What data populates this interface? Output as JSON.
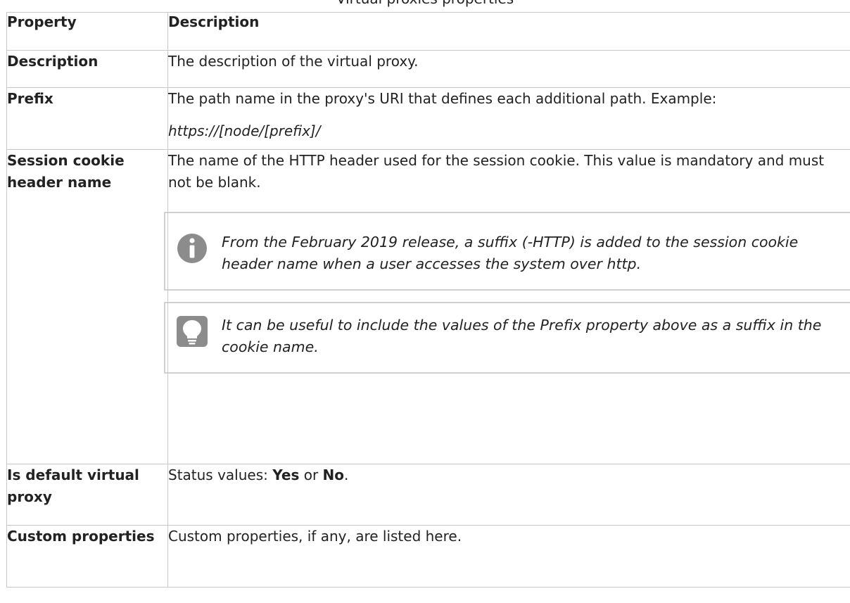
{
  "caption": "Virtual proxies properties",
  "table": {
    "headers": [
      "Property",
      "Description"
    ],
    "rows": {
      "description": {
        "property": "Description",
        "text": "The description of the virtual proxy."
      },
      "prefix": {
        "property": "Prefix",
        "text": "The path name in the proxy's URI that defines each additional path. Example:",
        "example": "https://[node/[prefix]/"
      },
      "session": {
        "property": "Session cookie header name",
        "text": "The name of the HTTP header used for the session cookie. This value is mandatory and must not be blank.",
        "note": "From the February 2019 release, a suffix (-HTTP) is added to the session cookie header name when a user accesses the system over http.",
        "tip": "It can be useful to include the values of the Prefix property above as a suffix in the cookie name."
      },
      "default": {
        "property": "Is default virtual proxy",
        "text_before": "Status values: ",
        "yes": "Yes",
        "or": " or ",
        "no": "No",
        "period": "."
      },
      "custom": {
        "property": "Custom properties",
        "text": "Custom properties, if any, are listed here."
      }
    }
  },
  "icons": {
    "note": "info-icon",
    "tip": "lightbulb-icon"
  },
  "colors": {
    "border": "#c8c8c8",
    "icon": "#8c8c8c",
    "text": "#222222"
  }
}
